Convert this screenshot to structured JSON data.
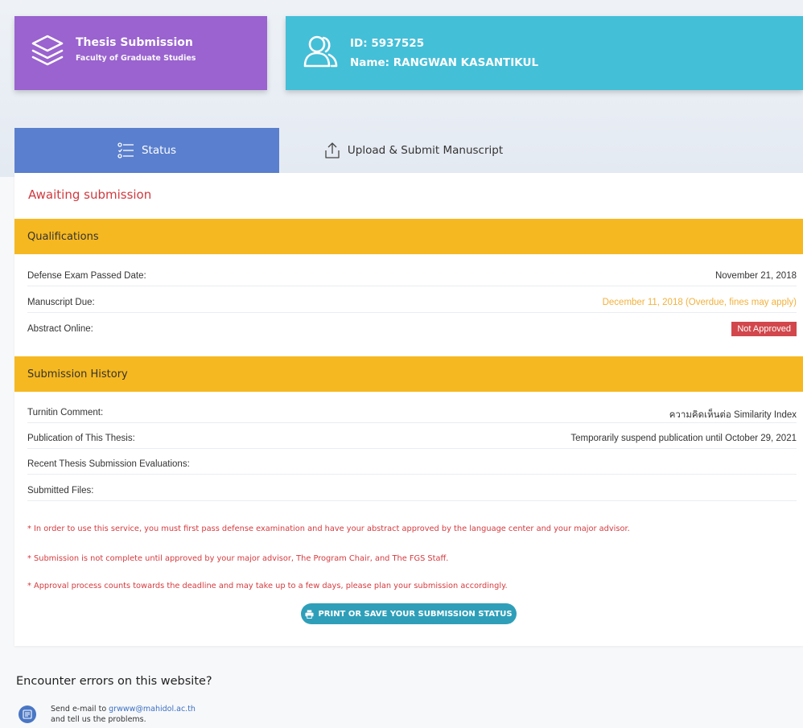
{
  "header": {
    "app_title": "Thesis Submission",
    "app_subtitle": "Faculty of Graduate Studies",
    "student_id_line": "ID: 5937525",
    "student_name_line": "Name: RANGWAN KASANTIKUL"
  },
  "tabs": [
    {
      "label": "Status",
      "icon": "checklist-icon",
      "active": true
    },
    {
      "label": "Upload & Submit Manuscript",
      "icon": "upload-icon",
      "active": false
    }
  ],
  "status": {
    "title": "Awaiting submission"
  },
  "qualifications": {
    "heading": "Qualifications",
    "rows": [
      {
        "label": "Defense Exam Passed Date:",
        "value": "November 21, 2018"
      },
      {
        "label": "Manuscript Due:",
        "value": "December 11, 2018 (Overdue, fines may apply)"
      },
      {
        "label": "Abstract Online:",
        "value": "Not Approved"
      }
    ]
  },
  "submission_history": {
    "heading": "Submission History",
    "rows": [
      {
        "label": "Turnitin Comment:",
        "value": "ความคิดเห็นต่อ Similarity Index"
      },
      {
        "label": "Publication of This Thesis:",
        "value": "Temporarily suspend publication until October 29, 2021"
      },
      {
        "label": "Recent Thesis Submission Evaluations:",
        "value": ""
      },
      {
        "label": "Submitted Files:",
        "value": ""
      }
    ]
  },
  "notes": [
    "* In order to use this service, you must first pass defense examination and have your abstract approved by the language center and your major advisor.",
    "* Submission is not complete until approved by your major advisor, The Program Chair, and The FGS Staff.",
    "* Approval process counts towards the deadline and may take up to a few days, please plan your submission accordingly."
  ],
  "print_button": {
    "label": "PRINT OR SAVE YOUR SUBMISSION STATUS",
    "icon": "printer-icon"
  },
  "footer": {
    "title": "Encounter errors on this website?",
    "mail_prefix": "Send e-mail to ",
    "mail_address": "grwww@mahidol.ac.th",
    "mail_suffix": "and tell us the problems.",
    "icon": "mail-icon"
  },
  "colors": {
    "thesis_card": "#9a63cf",
    "id_card": "#44bfd8",
    "active_tab": "#5a7fce",
    "section_bar": "#f6b820",
    "alert_red": "#d0393f",
    "overdue_orange": "#f2b13b",
    "print_button": "#2f9fb9"
  }
}
